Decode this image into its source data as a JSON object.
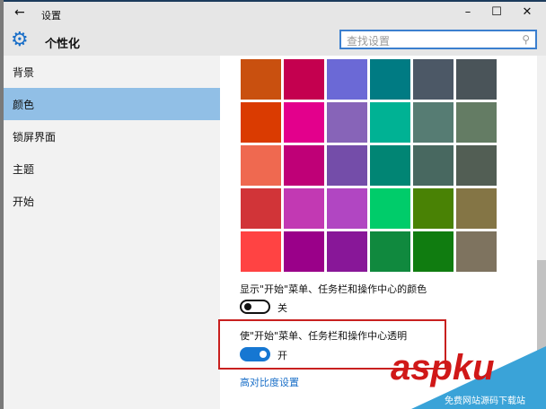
{
  "window": {
    "title": "设置",
    "back_icon": "←",
    "minimize": "–",
    "maximize": "☐",
    "close": "✕"
  },
  "header": {
    "title": "个性化",
    "search_placeholder": "查找设置",
    "search_icon": "⚲"
  },
  "sidebar": {
    "items": [
      {
        "label": "背景"
      },
      {
        "label": "颜色",
        "selected": true
      },
      {
        "label": "锁屏界面"
      },
      {
        "label": "主题"
      },
      {
        "label": "开始"
      }
    ]
  },
  "palette": [
    [
      "#c9500f",
      "#c4004f",
      "#6b69d6",
      "#007b83",
      "#4c5866",
      "#4a5459"
    ],
    [
      "#da3b01",
      "#e3008c",
      "#8764b8",
      "#00b294",
      "#567c73",
      "#647c64"
    ],
    [
      "#ef6950",
      "#bf0077",
      "#744da9",
      "#018574",
      "#486860",
      "#525e54"
    ],
    [
      "#d13438",
      "#c239b3",
      "#b146c2",
      "#00cc6a",
      "#498205",
      "#847545"
    ],
    [
      "#ff4343",
      "#9a0089",
      "#881798",
      "#10893e",
      "#107c10",
      "#7e735f"
    ]
  ],
  "settings": {
    "show_color_label": "显示\"开始\"菜单、任务栏和操作中心的颜色",
    "show_color_state": "关",
    "transparent_label": "使\"开始\"菜单、任务栏和操作中心透明",
    "transparent_state": "开",
    "high_contrast_link": "高对比度设置"
  },
  "watermark": {
    "logo": "aspku.com",
    "sub": "免费网站源码下载站"
  }
}
